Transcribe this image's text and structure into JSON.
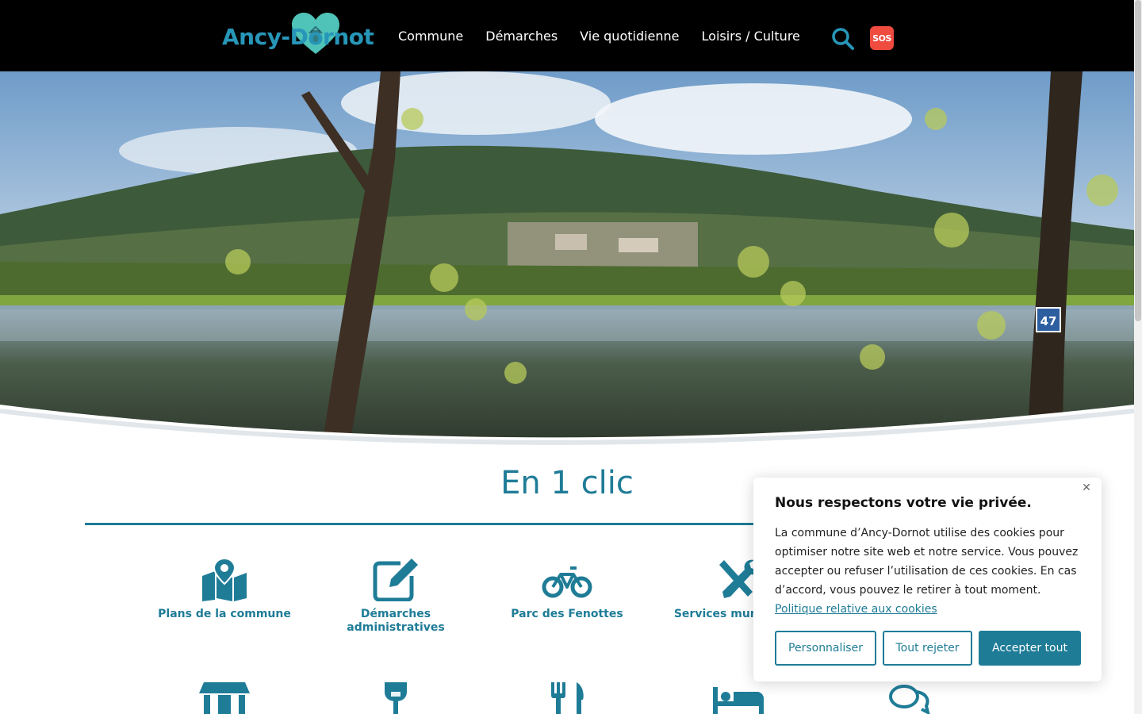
{
  "header": {
    "logo_text": "Ancy-Dornot",
    "nav": [
      "Commune",
      "Démarches",
      "Vie quotidienne",
      "Loisirs / Culture"
    ],
    "sos_label": "SOS"
  },
  "hero": {
    "sign_number": "47"
  },
  "one_click": {
    "title": "En 1 clic",
    "tiles": [
      {
        "label": "Plans de la commune",
        "icon": "map-pin-icon"
      },
      {
        "label": "Démarches administratives",
        "icon": "edit-icon"
      },
      {
        "label": "Parc des Fenottes",
        "icon": "bicycle-icon"
      },
      {
        "label": "Services municipaux",
        "icon": "tools-icon"
      }
    ],
    "row2_icons": [
      "store-icon",
      "wine-glass-icon",
      "utensils-icon",
      "bed-icon",
      "comments-icon"
    ]
  },
  "cookie": {
    "title": "Nous respectons votre vie privée.",
    "body": "La commune d’Ancy-Dornot utilise des cookies pour optimiser notre site web et notre service. Vous pouvez accepter ou refuser l’utilisation de ces cookies. En cas d’accord, vous pouvez le retirer à tout moment.",
    "link": "Politique relative aux cookies",
    "buttons": {
      "customize": "Personnaliser",
      "reject": "Tout rejeter",
      "accept": "Accepter tout"
    }
  },
  "colors": {
    "brand": "#1f7c97",
    "sos": "#ef4b3f",
    "header_bg": "#000000"
  }
}
